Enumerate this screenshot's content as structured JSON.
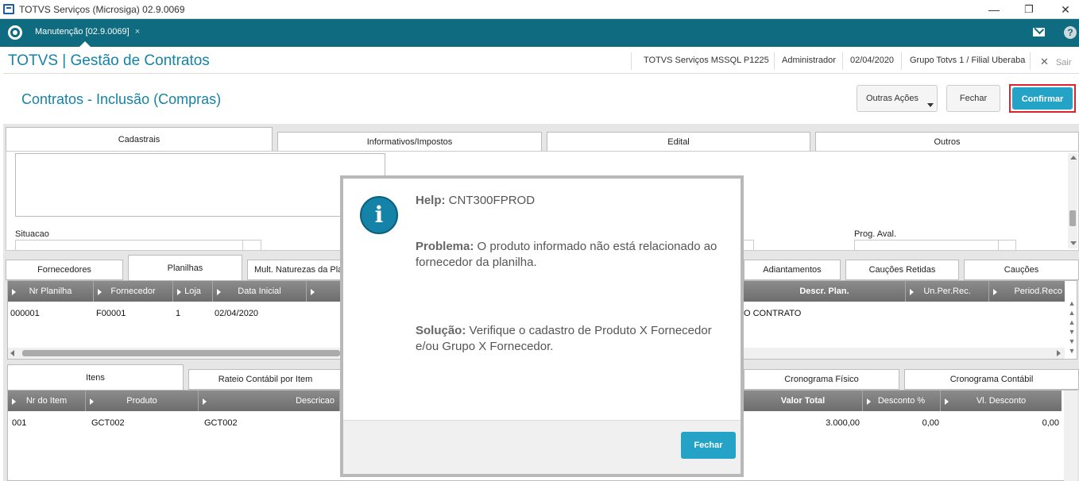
{
  "window": {
    "title": "TOTVS Serviços (Microsiga) 02.9.0069"
  },
  "tabbar": {
    "tab_label": "Manutenção [02.9.0069]",
    "close_glyph": "×"
  },
  "header": {
    "brand": "TOTVS | Gestão de Contratos",
    "environment": "TOTVS Serviços MSSQL P1225",
    "user": "Administrador",
    "date": "02/04/2020",
    "branch": "Grupo Totvs 1 / Filial Uberaba",
    "exit_label": "Sair"
  },
  "page": {
    "title": "Contratos - Inclusão (Compras)",
    "actions": {
      "more": "Outras Ações",
      "close": "Fechar",
      "confirm": "Confirmar"
    }
  },
  "form_tabs": [
    "Cadastrais",
    "Informativos/Impostos",
    "Edital",
    "Outros"
  ],
  "form": {
    "situacao_label": "Situacao",
    "prog_aval_label": "Prog. Aval."
  },
  "upper_tabs": [
    "Fornecedores",
    "Planilhas",
    "Mult. Naturezas da Pla",
    "Adiantamentos",
    "Cauções Retidas",
    "Cauções"
  ],
  "planilhas_grid": {
    "columns": [
      "Nr Planilha",
      "Fornecedor",
      "Loja",
      "Data Inicial",
      "Descr. Plan.",
      "Un.Per.Rec.",
      "Period.Reco"
    ],
    "row": {
      "nr": "000001",
      "fornecedor": "F00001",
      "loja": "1",
      "data": "02/04/2020",
      "descr": "O CONTRATO"
    }
  },
  "lower_tabs": [
    "Itens",
    "Rateio Contábil por Item",
    "Cronograma Físico",
    "Cronograma Contábil"
  ],
  "itens_grid": {
    "columns": [
      "Nr do Item",
      "Produto",
      "Descricao",
      "Valor Total",
      "Desconto %",
      "Vl. Desconto"
    ],
    "row": {
      "item": "001",
      "produto": "GCT002",
      "descricao": "GCT002",
      "valor_total": "3.000,00",
      "desconto": "0,00",
      "vl_desconto": "0,00"
    }
  },
  "dialog": {
    "help_label": "Help:",
    "help_code": "CNT300FPROD",
    "problem_label": "Problema:",
    "problem_text": "O produto informado não está relacionado ao fornecedor da planilha.",
    "solution_label": "Solução:",
    "solution_text": "Verifique o cadastro de Produto X Fornecedor e/ou Grupo X Fornecedor.",
    "close_label": "Fechar",
    "icon_glyph": "i"
  },
  "colors": {
    "teal_bar": "#0f6b7f",
    "brand_blue": "#1583a8",
    "confirm_bg": "#24a3c7",
    "confirm_outline": "#d9232d"
  }
}
